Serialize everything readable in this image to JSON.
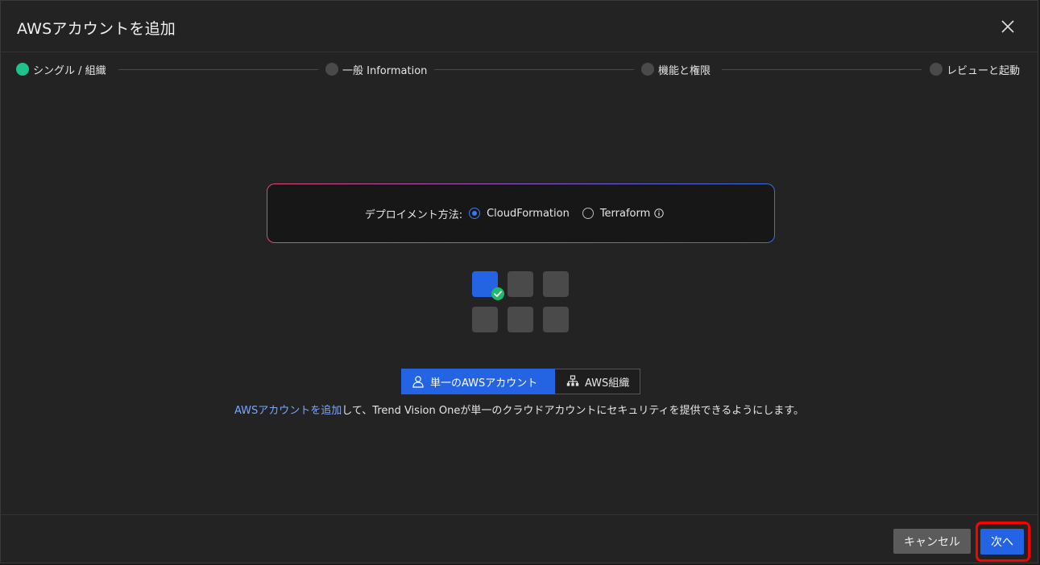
{
  "dialog": {
    "title": "AWSアカウントを追加"
  },
  "stepper": {
    "steps": [
      {
        "label": "シングル / 組織",
        "active": true
      },
      {
        "label": "一般 Information",
        "active": false
      },
      {
        "label": "機能と権限",
        "active": false
      },
      {
        "label": "レビューと起動",
        "active": false
      }
    ]
  },
  "deployment": {
    "label": "デプロイメント方法:",
    "options": [
      {
        "label": "CloudFormation",
        "checked": true
      },
      {
        "label": "Terraform",
        "checked": false
      }
    ]
  },
  "account_type": {
    "options": [
      {
        "label": "単一のAWSアカウント",
        "icon": "user-icon",
        "selected": true
      },
      {
        "label": "AWS組織",
        "icon": "org-tree-icon",
        "selected": false
      }
    ]
  },
  "description": {
    "link_text": "AWSアカウントを追加",
    "rest_text": "して、Trend Vision Oneが単一のクラウドアカウントにセキュリティを提供できるようにします。"
  },
  "footer": {
    "cancel_label": "キャンセル",
    "next_label": "次へ"
  },
  "colors": {
    "accent": "#2463e3",
    "step_active": "#1fc28b",
    "highlight": "#ff0000"
  }
}
